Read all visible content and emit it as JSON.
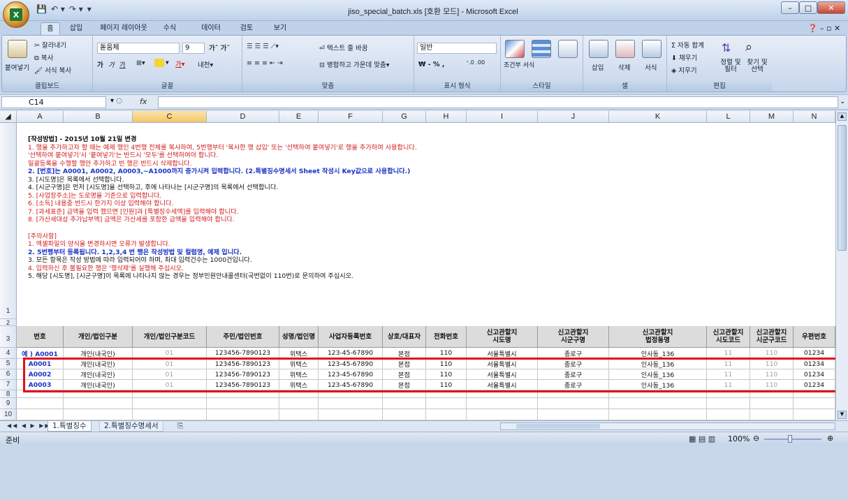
{
  "window": {
    "title": "jiso_special_batch.xls  [호환 모드]  -  Microsoft Excel",
    "qat": [
      "💾",
      "↶ ▾",
      "↷ ▾",
      "▾"
    ]
  },
  "tabs": [
    "홈",
    "삽입",
    "페이지 레이아웃",
    "수식",
    "데이터",
    "검토",
    "보기"
  ],
  "ribbon": {
    "clipboard": {
      "paste": "붙여넣기",
      "cut": "잘라내기",
      "copy": "복사",
      "format_painter": "서식 복사",
      "label": "클립보드"
    },
    "font": {
      "name": "돋움체",
      "size": "9",
      "bold": "가",
      "italic": "가",
      "underline": "가",
      "label": "글꼴"
    },
    "align": {
      "wrap": "텍스트 줄 바꿈",
      "merge": "병합하고 가운데 맞춤",
      "label": "맞춤"
    },
    "number": {
      "format": "일반",
      "currency": "₩ - %  ,",
      "label": "표시 형식"
    },
    "styles": {
      "cond": "조건부 서식",
      "table": "표 서식",
      "cell": "셀 스타일",
      "label": "스타일"
    },
    "cells": {
      "insert": "삽입",
      "delete": "삭제",
      "format": "서식",
      "label": "셀"
    },
    "editing": {
      "autosum": "Σ 자동 합계",
      "fill": "채우기",
      "clear": "지우기",
      "sort": "정렬 및 필터",
      "find": "찾기 및 선택",
      "label": "편집"
    }
  },
  "formula_bar": {
    "name_box": "C14",
    "fx": "fx",
    "value": ""
  },
  "columns": [
    "A",
    "B",
    "C",
    "D",
    "E",
    "F",
    "G",
    "H",
    "I",
    "J",
    "K",
    "L",
    "M",
    "N"
  ],
  "notes": [
    {
      "cls": "nbk",
      "text": "[작성방법] - 2015년 10월 21일 변경"
    },
    {
      "cls": "nr",
      "text": "1. 행을 추가하고자 할 때는 예제 행인 4번행 전체를 복사하여, 5번행부터 '복사한 행 삽입' 또는 '선택하여 붙여넣기'로 행을 추가하여 사용합니다."
    },
    {
      "cls": "nr",
      "text": "   '선택하여 붙여넣기'시 '붙여넣기'는 반드시 '모두'를 선택하여야 합니다."
    },
    {
      "cls": "nr",
      "text": "   일괄등록을 수행할 행만 추가하고 빈 행은 반드시 삭제합니다."
    },
    {
      "cls": "nb",
      "text": "2. [번호]는 A0001, A0002, A0003,~A1000까지 증가시켜 입력합니다. (2.특별징수명세서 Sheet 작성시 Key값으로 사용합니다.)"
    },
    {
      "cls": "nk",
      "text": "3. [시도명]은 목록에서 선택합니다."
    },
    {
      "cls": "nk",
      "text": "4. [시군구명]은 먼저 [시도명]을 선택하고, 후에 나타나는 [시군구명]의 목록에서 선택합니다."
    },
    {
      "cls": "nr",
      "text": "5. [사업장주소]는 도로명을 기준으로 입력합니다."
    },
    {
      "cls": "nr",
      "text": "6. [소득] 내용중 반드시 한가지 이상 입력해야 합니다."
    },
    {
      "cls": "nr",
      "text": "7. [과세표준] 금액을 입력 했으면 [인원]과 [특별징수세액]를 입력해야 합니다."
    },
    {
      "cls": "nr",
      "text": "8. [가산세대상 추가납부액] 금액은 가산세를 포함한 금액을 입력해야 합니다."
    },
    {
      "cls": "nk",
      "text": ""
    },
    {
      "cls": "nr",
      "text": "[주의사항]"
    },
    {
      "cls": "nr",
      "text": "1. 엑셀파일의 양식을 변경하시면 오류가 발생합니다."
    },
    {
      "cls": "nb",
      "text": "2. 5번행부터 등록됩니다. 1,2,3,4 번 행은 작성방법 및 컬럼명, 예제 입니다."
    },
    {
      "cls": "nk",
      "text": "3. 모든 항목은 작성 방법에 따라 입력되어야 하며, 최대 입력건수는 1000건입니다."
    },
    {
      "cls": "nr",
      "text": "4. 입력하신 후 불필요한 행은 '행삭제'를 실행해 주십시오."
    },
    {
      "cls": "nk",
      "text": "5. 해당 [시도명], [시군구명]이 목록에 나타나지 않는 경우는 정부민원안내콜센터(국번없이 110번)로 문의하여 주십시오."
    }
  ],
  "table": {
    "headers": [
      "번호",
      "개인/법인구분",
      "개인/법인구분코드",
      "주민/법인번호",
      "성명/법인명",
      "사업자등록번호",
      "상호/대표자",
      "전화번호",
      "신고관할지\n시도명",
      "신고관할지\n시군구명",
      "신고관할지\n법정동명",
      "신고관할지\n시도코드",
      "신고관할지\n시군구코드",
      "우편번호"
    ],
    "rows": [
      [
        "예 ) A0001",
        "개인(내국인)",
        "01",
        "123456-7890123",
        "위택스",
        "123-45-67890",
        "본점",
        "110",
        "서울특별시",
        "종로구",
        "인사동_136",
        "11",
        "110",
        "01234"
      ],
      [
        "A0001",
        "개인(내국인)",
        "01",
        "123456-7890123",
        "위택스",
        "123-45-67890",
        "본점",
        "110",
        "서울특별시",
        "종로구",
        "인사동_136",
        "11",
        "110",
        "01234"
      ],
      [
        "A0002",
        "개인(내국인)",
        "01",
        "123456-7890123",
        "위택스",
        "123-45-67890",
        "본점",
        "110",
        "서울특별시",
        "종로구",
        "인사동_136",
        "11",
        "110",
        "01234"
      ],
      [
        "A0003",
        "개인(내국인)",
        "01",
        "123456-7890123",
        "위택스",
        "123-45-67890",
        "본점",
        "110",
        "서울특별시",
        "종로구",
        "인사동_136",
        "11",
        "110",
        "01234"
      ]
    ]
  },
  "row_numbers": [
    "1",
    "2",
    "3",
    "4",
    "5",
    "6",
    "7",
    "8",
    "9",
    "10"
  ],
  "sheet_tabs": [
    "1.특별징수",
    "2.특별징수명세서"
  ],
  "status": {
    "ready": "준비",
    "zoom": "100%"
  }
}
